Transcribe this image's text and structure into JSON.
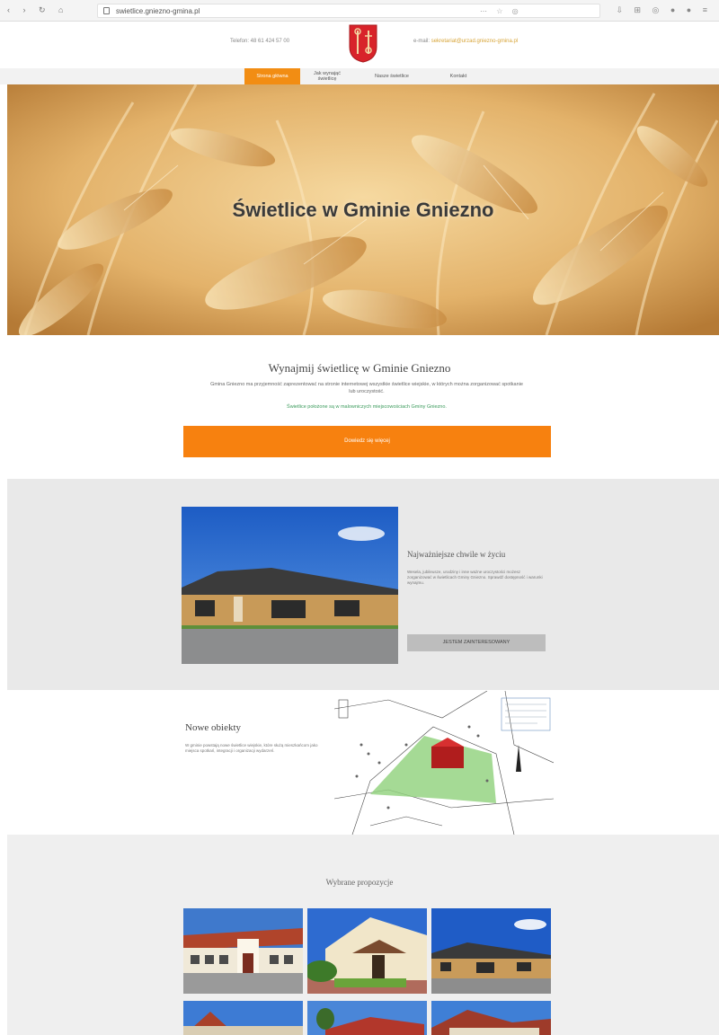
{
  "browser": {
    "url": "swietlice.gniezno-gmina.pl",
    "nav_icons": "‹ › ↻ ⌂",
    "url_icons": "⋯ ☆ ◎",
    "right_icons": "⇩ ⊞ ◎ ● ● ≡"
  },
  "header": {
    "phone": "Telefon: 48 61 424 57 00",
    "email_label": "e-mail:",
    "email": "sekretariat@urzad.gniezno-gmina.pl"
  },
  "nav": [
    {
      "label": "Strona główna"
    },
    {
      "label1": "Jak wynająć",
      "label2": "świetlicę"
    },
    {
      "label": "Nasze świetlice"
    },
    {
      "label": "Kontakt"
    }
  ],
  "hero": {
    "title": "Świetlice w Gminie Gniezno"
  },
  "intro": {
    "title": "Wynajmij świetlicę w Gminie Gniezno",
    "text": "Gmina Gniezno ma przyjemność zaprezentować na stronie internetowej wszystkie świetlice wiejskie, w których można zorganizować spotkanie lub uroczystość.",
    "small": "Świetlice położone są w malowniczych miejscowościach Gminy Gniezno.",
    "cta": "Dowiedz się więcej"
  },
  "feature": {
    "title": "Najważniejsze chwile w życiu",
    "text": "Wesela, jubileusze, urodziny i inne ważne uroczystości możesz zorganizować w świetlicach Gminy Gniezno. Sprawdź dostępność i warunki wynajmu.",
    "button": "JESTEM ZAINTERESOWANY"
  },
  "new_objects": {
    "title": "Nowe obiekty",
    "text": "W gminie powstają nowe świetlice wiejskie, które służą mieszkańcom jako miejsca spotkań, integracji i organizacji wydarzeń."
  },
  "proposals": {
    "title": "Wybrane propozycje"
  },
  "colors": {
    "accent": "#f7810f",
    "grey": "#e9e9e9",
    "green": "#3a9a5b"
  }
}
